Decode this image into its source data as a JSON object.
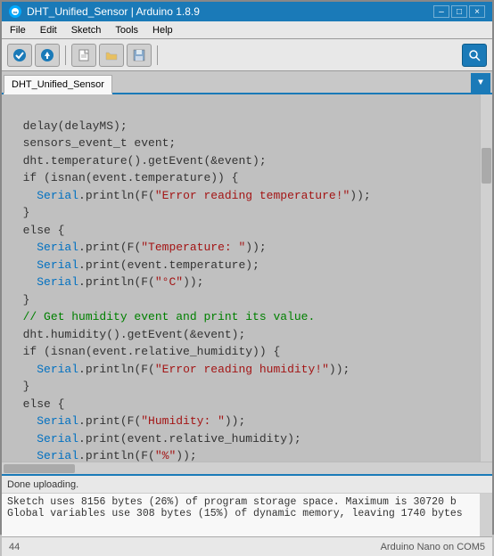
{
  "titleBar": {
    "title": "DHT_Unified_Sensor | Arduino 1.8.9",
    "icon": "arduino-icon",
    "minimizeLabel": "–",
    "maximizeLabel": "□",
    "closeLabel": "×"
  },
  "menuBar": {
    "items": [
      "File",
      "Edit",
      "Sketch",
      "Tools",
      "Help"
    ]
  },
  "toolbar": {
    "buttons": [
      {
        "icon": "▶",
        "name": "verify-button"
      },
      {
        "icon": "→",
        "name": "upload-button"
      },
      {
        "icon": "📄",
        "name": "new-button"
      },
      {
        "icon": "📂",
        "name": "open-button"
      },
      {
        "icon": "💾",
        "name": "save-button"
      }
    ],
    "searchIcon": "🔍"
  },
  "tab": {
    "label": "DHT_Unified_Sensor",
    "dropdownIcon": "▼"
  },
  "code": [
    "",
    "  delay(delayMS);",
    "  sensors_event_t event;",
    "  dht.temperature().getEvent(&event);",
    "  if (isnan(event.temperature)) {",
    "    Serial.println(F(\"Error reading temperature!\"));",
    "  }",
    "  else {",
    "    Serial.print(F(\"Temperature: \"));",
    "    Serial.print(event.temperature);",
    "    Serial.println(F(\"°C\"));",
    "  }",
    "  // Get humidity event and print its value.",
    "  dht.humidity().getEvent(&event);",
    "  if (isnan(event.relative_humidity)) {",
    "    Serial.println(F(\"Error reading humidity!\"));",
    "  }",
    "  else {",
    "    Serial.print(F(\"Humidity: \"));",
    "    Serial.print(event.relative_humidity);",
    "    Serial.println(F(\"%\"));",
    "  }",
    "}"
  ],
  "consoleStatus": "Done uploading.",
  "consoleOutput": [
    "Sketch uses 8156 bytes (26%) of program storage space. Maximum is 30720 b",
    "Global variables use 308 bytes (15%) of dynamic memory, leaving 1740 bytes"
  ],
  "statusBar": {
    "lineNumber": "44",
    "board": "Arduino Nano on COM5"
  }
}
